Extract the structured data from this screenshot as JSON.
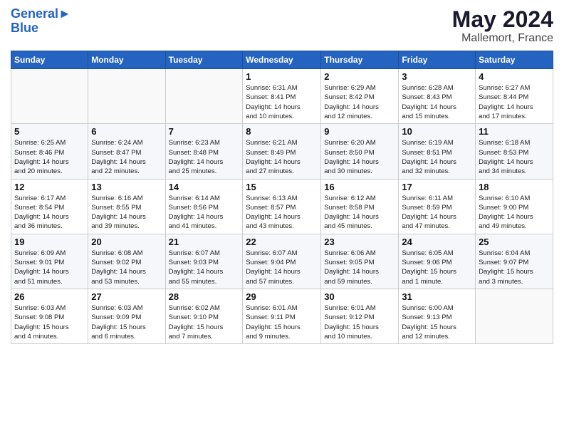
{
  "header": {
    "logo_line1": "General",
    "logo_line2": "Blue",
    "title": "May 2024",
    "subtitle": "Mallemort, France"
  },
  "days_of_week": [
    "Sunday",
    "Monday",
    "Tuesday",
    "Wednesday",
    "Thursday",
    "Friday",
    "Saturday"
  ],
  "weeks": [
    [
      {
        "day": "",
        "info": ""
      },
      {
        "day": "",
        "info": ""
      },
      {
        "day": "",
        "info": ""
      },
      {
        "day": "1",
        "info": "Sunrise: 6:31 AM\nSunset: 8:41 PM\nDaylight: 14 hours\nand 10 minutes."
      },
      {
        "day": "2",
        "info": "Sunrise: 6:29 AM\nSunset: 8:42 PM\nDaylight: 14 hours\nand 12 minutes."
      },
      {
        "day": "3",
        "info": "Sunrise: 6:28 AM\nSunset: 8:43 PM\nDaylight: 14 hours\nand 15 minutes."
      },
      {
        "day": "4",
        "info": "Sunrise: 6:27 AM\nSunset: 8:44 PM\nDaylight: 14 hours\nand 17 minutes."
      }
    ],
    [
      {
        "day": "5",
        "info": "Sunrise: 6:25 AM\nSunset: 8:46 PM\nDaylight: 14 hours\nand 20 minutes."
      },
      {
        "day": "6",
        "info": "Sunrise: 6:24 AM\nSunset: 8:47 PM\nDaylight: 14 hours\nand 22 minutes."
      },
      {
        "day": "7",
        "info": "Sunrise: 6:23 AM\nSunset: 8:48 PM\nDaylight: 14 hours\nand 25 minutes."
      },
      {
        "day": "8",
        "info": "Sunrise: 6:21 AM\nSunset: 8:49 PM\nDaylight: 14 hours\nand 27 minutes."
      },
      {
        "day": "9",
        "info": "Sunrise: 6:20 AM\nSunset: 8:50 PM\nDaylight: 14 hours\nand 30 minutes."
      },
      {
        "day": "10",
        "info": "Sunrise: 6:19 AM\nSunset: 8:51 PM\nDaylight: 14 hours\nand 32 minutes."
      },
      {
        "day": "11",
        "info": "Sunrise: 6:18 AM\nSunset: 8:53 PM\nDaylight: 14 hours\nand 34 minutes."
      }
    ],
    [
      {
        "day": "12",
        "info": "Sunrise: 6:17 AM\nSunset: 8:54 PM\nDaylight: 14 hours\nand 36 minutes."
      },
      {
        "day": "13",
        "info": "Sunrise: 6:16 AM\nSunset: 8:55 PM\nDaylight: 14 hours\nand 39 minutes."
      },
      {
        "day": "14",
        "info": "Sunrise: 6:14 AM\nSunset: 8:56 PM\nDaylight: 14 hours\nand 41 minutes."
      },
      {
        "day": "15",
        "info": "Sunrise: 6:13 AM\nSunset: 8:57 PM\nDaylight: 14 hours\nand 43 minutes."
      },
      {
        "day": "16",
        "info": "Sunrise: 6:12 AM\nSunset: 8:58 PM\nDaylight: 14 hours\nand 45 minutes."
      },
      {
        "day": "17",
        "info": "Sunrise: 6:11 AM\nSunset: 8:59 PM\nDaylight: 14 hours\nand 47 minutes."
      },
      {
        "day": "18",
        "info": "Sunrise: 6:10 AM\nSunset: 9:00 PM\nDaylight: 14 hours\nand 49 minutes."
      }
    ],
    [
      {
        "day": "19",
        "info": "Sunrise: 6:09 AM\nSunset: 9:01 PM\nDaylight: 14 hours\nand 51 minutes."
      },
      {
        "day": "20",
        "info": "Sunrise: 6:08 AM\nSunset: 9:02 PM\nDaylight: 14 hours\nand 53 minutes."
      },
      {
        "day": "21",
        "info": "Sunrise: 6:07 AM\nSunset: 9:03 PM\nDaylight: 14 hours\nand 55 minutes."
      },
      {
        "day": "22",
        "info": "Sunrise: 6:07 AM\nSunset: 9:04 PM\nDaylight: 14 hours\nand 57 minutes."
      },
      {
        "day": "23",
        "info": "Sunrise: 6:06 AM\nSunset: 9:05 PM\nDaylight: 14 hours\nand 59 minutes."
      },
      {
        "day": "24",
        "info": "Sunrise: 6:05 AM\nSunset: 9:06 PM\nDaylight: 15 hours\nand 1 minute."
      },
      {
        "day": "25",
        "info": "Sunrise: 6:04 AM\nSunset: 9:07 PM\nDaylight: 15 hours\nand 3 minutes."
      }
    ],
    [
      {
        "day": "26",
        "info": "Sunrise: 6:03 AM\nSunset: 9:08 PM\nDaylight: 15 hours\nand 4 minutes."
      },
      {
        "day": "27",
        "info": "Sunrise: 6:03 AM\nSunset: 9:09 PM\nDaylight: 15 hours\nand 6 minutes."
      },
      {
        "day": "28",
        "info": "Sunrise: 6:02 AM\nSunset: 9:10 PM\nDaylight: 15 hours\nand 7 minutes."
      },
      {
        "day": "29",
        "info": "Sunrise: 6:01 AM\nSunset: 9:11 PM\nDaylight: 15 hours\nand 9 minutes."
      },
      {
        "day": "30",
        "info": "Sunrise: 6:01 AM\nSunset: 9:12 PM\nDaylight: 15 hours\nand 10 minutes."
      },
      {
        "day": "31",
        "info": "Sunrise: 6:00 AM\nSunset: 9:13 PM\nDaylight: 15 hours\nand 12 minutes."
      },
      {
        "day": "",
        "info": ""
      }
    ]
  ]
}
